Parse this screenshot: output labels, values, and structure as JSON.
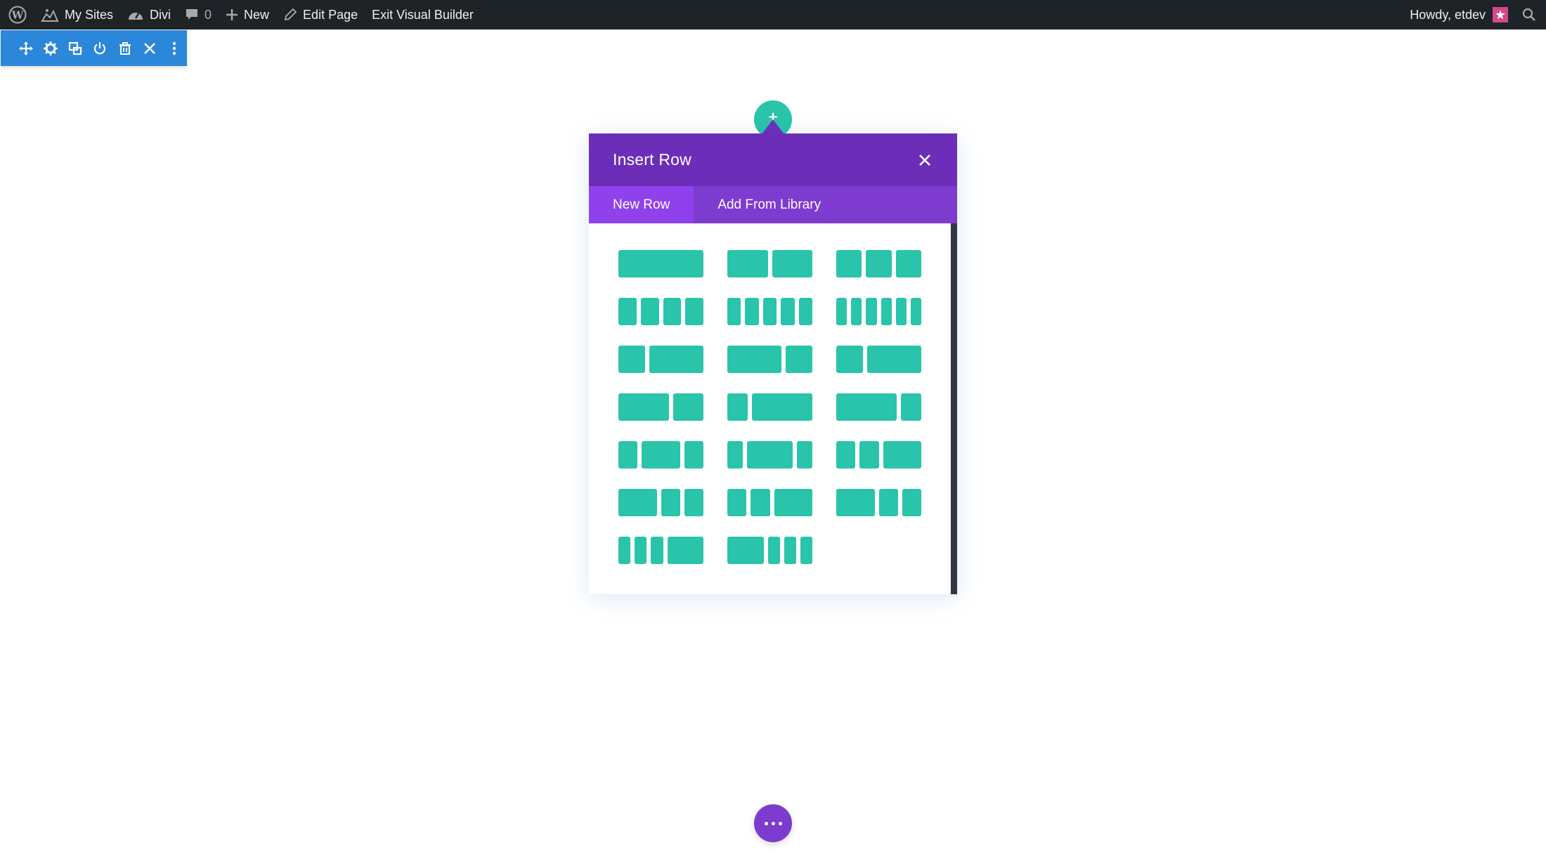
{
  "admin_bar": {
    "my_sites": "My Sites",
    "divi": "Divi",
    "comments_count": "0",
    "new": "New",
    "edit_page": "Edit Page",
    "exit_builder": "Exit Visual Builder",
    "howdy": "Howdy, etdev"
  },
  "section_toolbar": {
    "icons": [
      "move-icon",
      "gear-icon",
      "duplicate-icon",
      "power-icon",
      "trash-icon",
      "close-icon",
      "more-vertical-icon"
    ]
  },
  "modal": {
    "title": "Insert Row",
    "tabs": [
      {
        "label": "New Row",
        "active": true
      },
      {
        "label": "Add From Library",
        "active": false
      }
    ],
    "layouts": [
      [
        "1"
      ],
      [
        "1",
        "1"
      ],
      [
        "1",
        "1",
        "1"
      ],
      [
        "1",
        "1",
        "1",
        "1"
      ],
      [
        "1",
        "1",
        "1",
        "1",
        "1"
      ],
      [
        "1",
        "1",
        "1",
        "1",
        "1",
        "1"
      ],
      [
        "1",
        "2"
      ],
      [
        "2",
        "1"
      ],
      [
        "1",
        "2"
      ],
      [
        "5",
        "3"
      ],
      [
        "1",
        "3"
      ],
      [
        "3",
        "1"
      ],
      [
        "1",
        "2",
        "1"
      ],
      [
        "1",
        "3",
        "1"
      ],
      [
        "1",
        "1",
        "2"
      ],
      [
        "2",
        "1",
        "1"
      ],
      [
        "1",
        "1",
        "2"
      ],
      [
        "2",
        "1",
        "1"
      ],
      [
        "1",
        "1",
        "1",
        "3"
      ],
      [
        "3",
        "1",
        "1",
        "1"
      ]
    ]
  },
  "colors": {
    "admin_bar": "#1d2327",
    "toolbar_blue": "#2b87da",
    "modal_header": "#6c2eb9",
    "tab_bar": "#7e3bd0",
    "tab_active": "#8f42ec",
    "teal": "#29c4a9",
    "avatar_pink": "#d4478d"
  }
}
